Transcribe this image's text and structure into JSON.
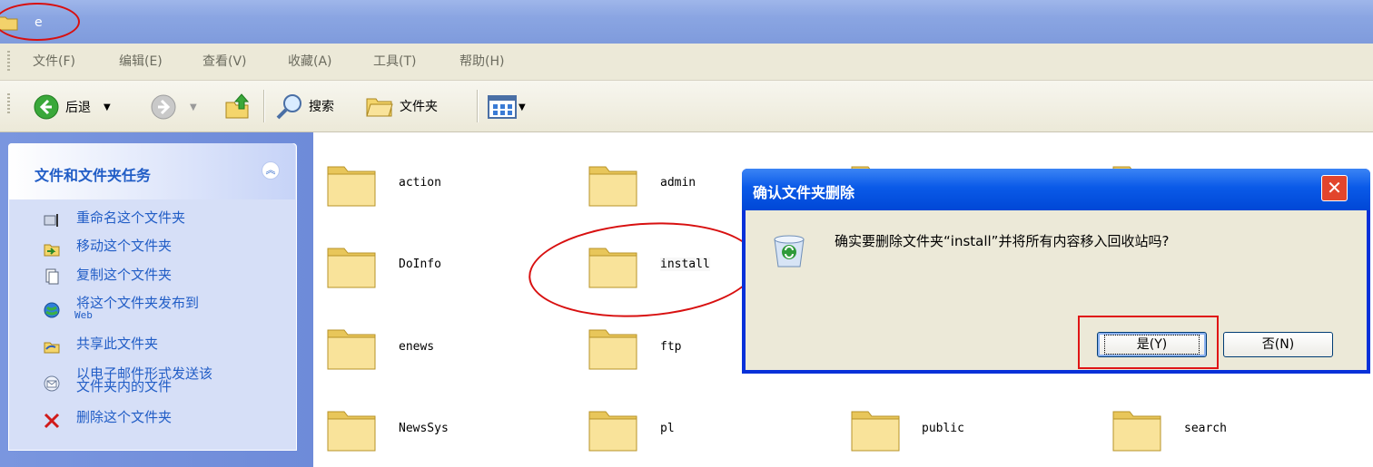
{
  "window": {
    "title": "e"
  },
  "menu": [
    "文件(F)",
    "编辑(E)",
    "查看(V)",
    "收藏(A)",
    "工具(T)",
    "帮助(H)"
  ],
  "toolbar": {
    "back": "后退",
    "search": "搜索",
    "folders": "文件夹"
  },
  "tasks": {
    "heading": "文件和文件夹任务",
    "items": [
      {
        "label": "重命名这个文件夹",
        "icon": "rename-icon"
      },
      {
        "label": "移动这个文件夹",
        "icon": "move-icon"
      },
      {
        "label": "复制这个文件夹",
        "icon": "copy-icon"
      },
      {
        "label": "将这个文件夹发布到",
        "sub": "Web",
        "icon": "publish-web-icon"
      },
      {
        "label": "共享此文件夹",
        "icon": "share-icon"
      },
      {
        "label": "以电子邮件形式发送该",
        "sub": "文件夹内的文件",
        "icon": "email-icon"
      },
      {
        "label": "删除这个文件夹",
        "icon": "delete-icon"
      }
    ]
  },
  "folders": [
    "action",
    "admin",
    "DoInfo",
    "install",
    "enews",
    "ftp",
    "NewsSys",
    "pl",
    "public",
    "search"
  ],
  "dialog": {
    "title": "确认文件夹删除",
    "message": "确实要删除文件夹“install”并将所有内容移入回收站吗?",
    "yes": "是(Y)",
    "no": "否(N)"
  }
}
